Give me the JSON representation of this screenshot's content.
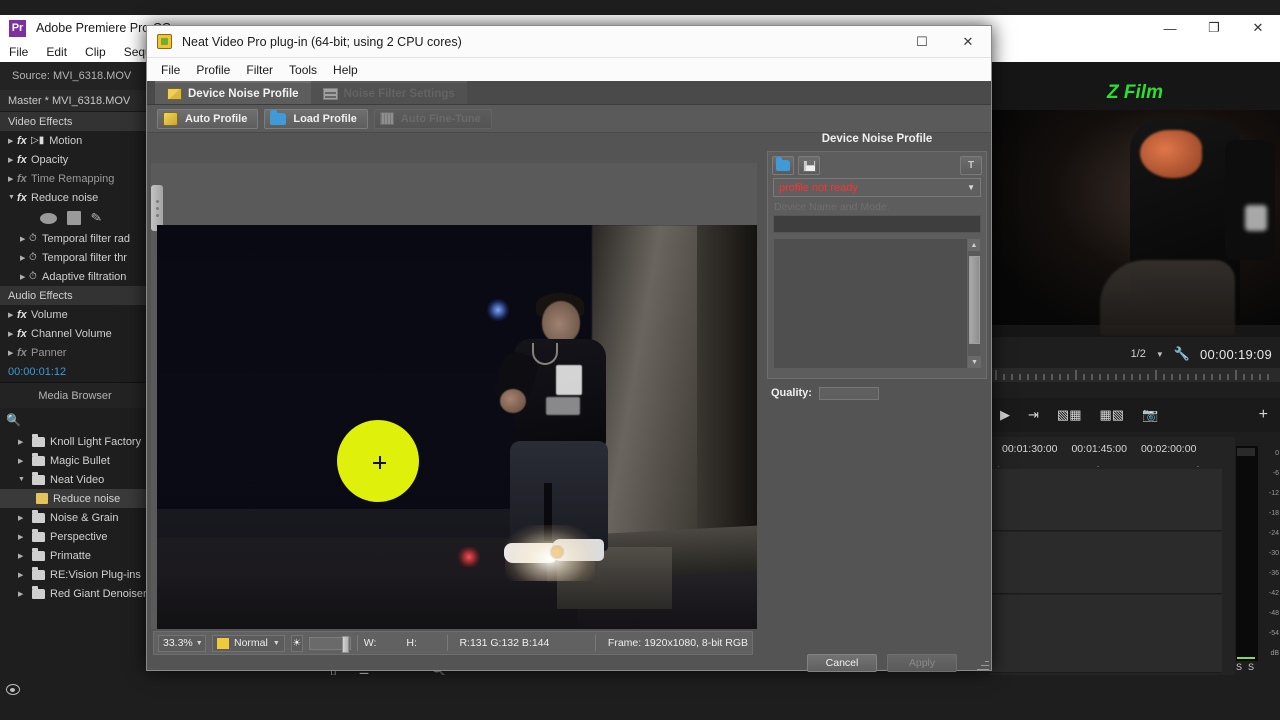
{
  "premiere": {
    "app_title": "Adobe Premiere Pro CC",
    "logo_text": "Pr",
    "menus": [
      "File",
      "Edit",
      "Clip",
      "Sequence"
    ],
    "window_buttons": [
      {
        "name": "minimize",
        "glyph": "—"
      },
      {
        "name": "restore",
        "glyph": "❐"
      },
      {
        "name": "close",
        "glyph": "✕"
      }
    ],
    "effect_controls": {
      "panel_tab": "Source: MVI_6318.MOV",
      "master_clip": "Master * MVI_6318.MOV",
      "video_effects_header": "Video Effects",
      "video_effects": [
        {
          "label": "Motion",
          "expanded": false,
          "dim": false,
          "has_motion_icon": true
        },
        {
          "label": "Opacity",
          "expanded": false,
          "dim": false,
          "has_motion_icon": false
        },
        {
          "label": "Time Remapping",
          "expanded": false,
          "dim": true,
          "has_motion_icon": false
        },
        {
          "label": "Reduce noise",
          "expanded": true,
          "dim": false,
          "has_motion_icon": false
        }
      ],
      "reduce_noise_params": [
        "Temporal filter rad",
        "Temporal filter thr",
        "Adaptive filtration"
      ],
      "audio_effects_header": "Audio Effects",
      "audio_effects": [
        {
          "label": "Volume",
          "dim": false
        },
        {
          "label": "Channel Volume",
          "dim": false
        },
        {
          "label": "Panner",
          "dim": true
        }
      ],
      "timecode": "00:00:01:12"
    },
    "media_browser": {
      "title": "Media Browser",
      "search_placeholder": "",
      "items": [
        {
          "label": "Knoll Light Factory",
          "type": "folder",
          "expanded": false,
          "selected": false
        },
        {
          "label": "Magic Bullet",
          "type": "folder",
          "expanded": false,
          "selected": false
        },
        {
          "label": "Neat Video",
          "type": "folder",
          "expanded": true,
          "selected": false
        },
        {
          "label": "Reduce noise",
          "type": "effect",
          "expanded": false,
          "selected": true
        },
        {
          "label": "Noise & Grain",
          "type": "folder",
          "expanded": false,
          "selected": false
        },
        {
          "label": "Perspective",
          "type": "folder",
          "expanded": false,
          "selected": false
        },
        {
          "label": "Primatte",
          "type": "folder",
          "expanded": false,
          "selected": false
        },
        {
          "label": "RE:Vision Plug-ins",
          "type": "folder",
          "expanded": false,
          "selected": false
        },
        {
          "label": "Red Giant Denoiser",
          "type": "folder",
          "expanded": false,
          "selected": false
        }
      ]
    },
    "monitor": {
      "watermark": "Z Film",
      "zoom_fraction": "1/2",
      "timecode": "00:00:19:09",
      "buttons": [
        "play",
        "export-frame",
        "insert",
        "overwrite",
        "snapshot",
        "add"
      ]
    },
    "timeline": {
      "timecodes": [
        "00:01:30:00",
        "00:01:45:00",
        "00:02:00:00"
      ]
    },
    "audio_meter": {
      "scale": [
        "0",
        "-6",
        "-12",
        "-18",
        "-24",
        "-30",
        "-36",
        "-42",
        "-48",
        "-54",
        "dB"
      ],
      "solo_labels": [
        "S",
        "S"
      ]
    }
  },
  "plugin": {
    "title": "Neat Video Pro plug-in (64-bit; using 2 CPU cores)",
    "window_buttons": [
      {
        "name": "maximize",
        "glyph": "☐"
      },
      {
        "name": "close",
        "glyph": "✕"
      }
    ],
    "menus": [
      "File",
      "Profile",
      "Filter",
      "Tools",
      "Help"
    ],
    "tabs": [
      {
        "label": "Device Noise Profile",
        "active": true
      },
      {
        "label": "Noise Filter Settings",
        "active": false
      }
    ],
    "toolbar": [
      {
        "label": "Auto Profile",
        "icon": "wand-icon",
        "disabled": false
      },
      {
        "label": "Load Profile",
        "icon": "folder-icon",
        "disabled": false
      },
      {
        "label": "Auto Fine-Tune",
        "icon": "grid-icon",
        "disabled": true
      }
    ],
    "device_noise_profile": {
      "header": "Device Noise Profile",
      "icon_buttons": [
        "open-profile-icon",
        "save-profile-icon",
        "text-info-icon"
      ],
      "profile_status": "profile not ready",
      "device_label": "Device Name and Mode:",
      "device_value": "",
      "quality_label": "Quality:",
      "quality_value": ""
    },
    "status_bar": {
      "zoom": "33.3%",
      "mode": "Normal",
      "brightness_icon": "sun-icon",
      "width_label": "W:",
      "width_value": "",
      "height_label": "H:",
      "height_value": "",
      "rgb_readout": "R:131 G:132 B:144",
      "frame_info": "Frame: 1920x1080, 8-bit RGB"
    },
    "footer": {
      "cancel_label": "Cancel",
      "apply_label": "Apply"
    }
  },
  "colors": {
    "profile_status": "#ff3030",
    "watermark": "#2ee02e",
    "spot_marker": "#dff00b",
    "timecode_blue": "#3a9ad9",
    "folder_blue": "#3f9ad8"
  }
}
